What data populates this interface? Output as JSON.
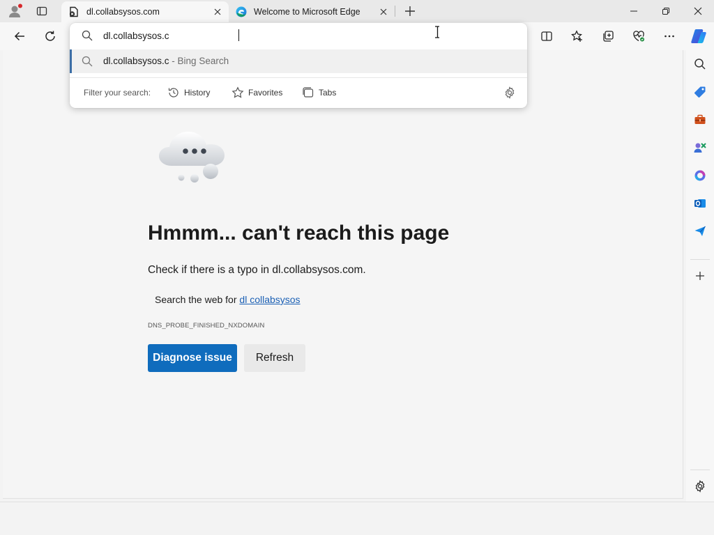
{
  "tabs": [
    {
      "title": "dl.collabsysos.com",
      "active": true,
      "favicon": "page-error-icon"
    },
    {
      "title": "Welcome to Microsoft Edge",
      "active": false,
      "favicon": "edge-logo-icon"
    }
  ],
  "omnibox": {
    "input_value": "dl.collabsysos.c",
    "suggestion": {
      "main": "dl.collabsysos.c",
      "suffix": " - Bing Search"
    },
    "filter_label": "Filter your search:",
    "filters": [
      {
        "label": "History",
        "icon": "history-icon"
      },
      {
        "label": "Favorites",
        "icon": "star-icon"
      },
      {
        "label": "Tabs",
        "icon": "tabs-icon"
      }
    ]
  },
  "page": {
    "title": "Hmmm... can't reach this page",
    "typo_hint": "Check if there is a typo in dl.collabsysos.com.",
    "search_prefix": "Search the web for ",
    "search_link": "dl collabsysos",
    "error_code": "DNS_PROBE_FINISHED_NXDOMAIN",
    "diagnose_label": "Diagnose issue",
    "refresh_label": "Refresh"
  },
  "colors": {
    "accent": "#0f6cbd",
    "link": "#1a5fb4"
  }
}
